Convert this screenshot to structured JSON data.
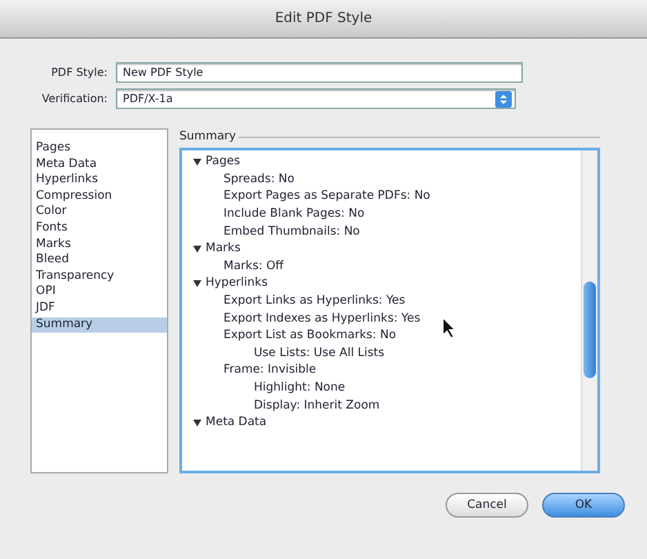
{
  "window": {
    "title": "Edit PDF Style"
  },
  "fields": [
    {
      "label": "PDF Style:",
      "kind": "text",
      "value": "New PDF Style"
    },
    {
      "label": "Verification:",
      "kind": "select",
      "value": "PDF/X-1a"
    }
  ],
  "sidebar": {
    "items": [
      {
        "label": "Pages",
        "selected": false
      },
      {
        "label": "Meta Data",
        "selected": false
      },
      {
        "label": "Hyperlinks",
        "selected": false
      },
      {
        "label": "Compression",
        "selected": false
      },
      {
        "label": "Color",
        "selected": false
      },
      {
        "label": "Fonts",
        "selected": false
      },
      {
        "label": "Marks",
        "selected": false
      },
      {
        "label": "Bleed",
        "selected": false
      },
      {
        "label": "Transparency",
        "selected": false
      },
      {
        "label": "OPI",
        "selected": false
      },
      {
        "label": "JDF",
        "selected": false
      },
      {
        "label": "Summary",
        "selected": true
      }
    ]
  },
  "summary": {
    "title": "Summary",
    "tree": [
      {
        "label": "Pages",
        "expanded": true,
        "children": [
          {
            "label": "Spreads: No"
          },
          {
            "label": "Export Pages as Separate PDFs: No"
          },
          {
            "label": "Include Blank Pages: No"
          },
          {
            "label": "Embed Thumbnails: No"
          }
        ]
      },
      {
        "label": "Marks",
        "expanded": true,
        "children": [
          {
            "label": "Marks: Off"
          }
        ]
      },
      {
        "label": "Hyperlinks",
        "expanded": true,
        "children": [
          {
            "label": "Export Links as Hyperlinks: Yes"
          },
          {
            "label": "Export Indexes as Hyperlinks: Yes"
          },
          {
            "label": "Export List as Bookmarks: No",
            "children": [
              {
                "label": "Use Lists: Use All Lists"
              }
            ]
          },
          {
            "label": "Frame: Invisible",
            "children": [
              {
                "label": "Highlight: None"
              },
              {
                "label": "Display: Inherit Zoom"
              }
            ]
          }
        ]
      },
      {
        "label": "Meta Data",
        "expanded": true
      }
    ]
  },
  "buttons": [
    {
      "label": "Cancel",
      "kind": "secondary"
    },
    {
      "label": "OK",
      "kind": "primary"
    }
  ]
}
